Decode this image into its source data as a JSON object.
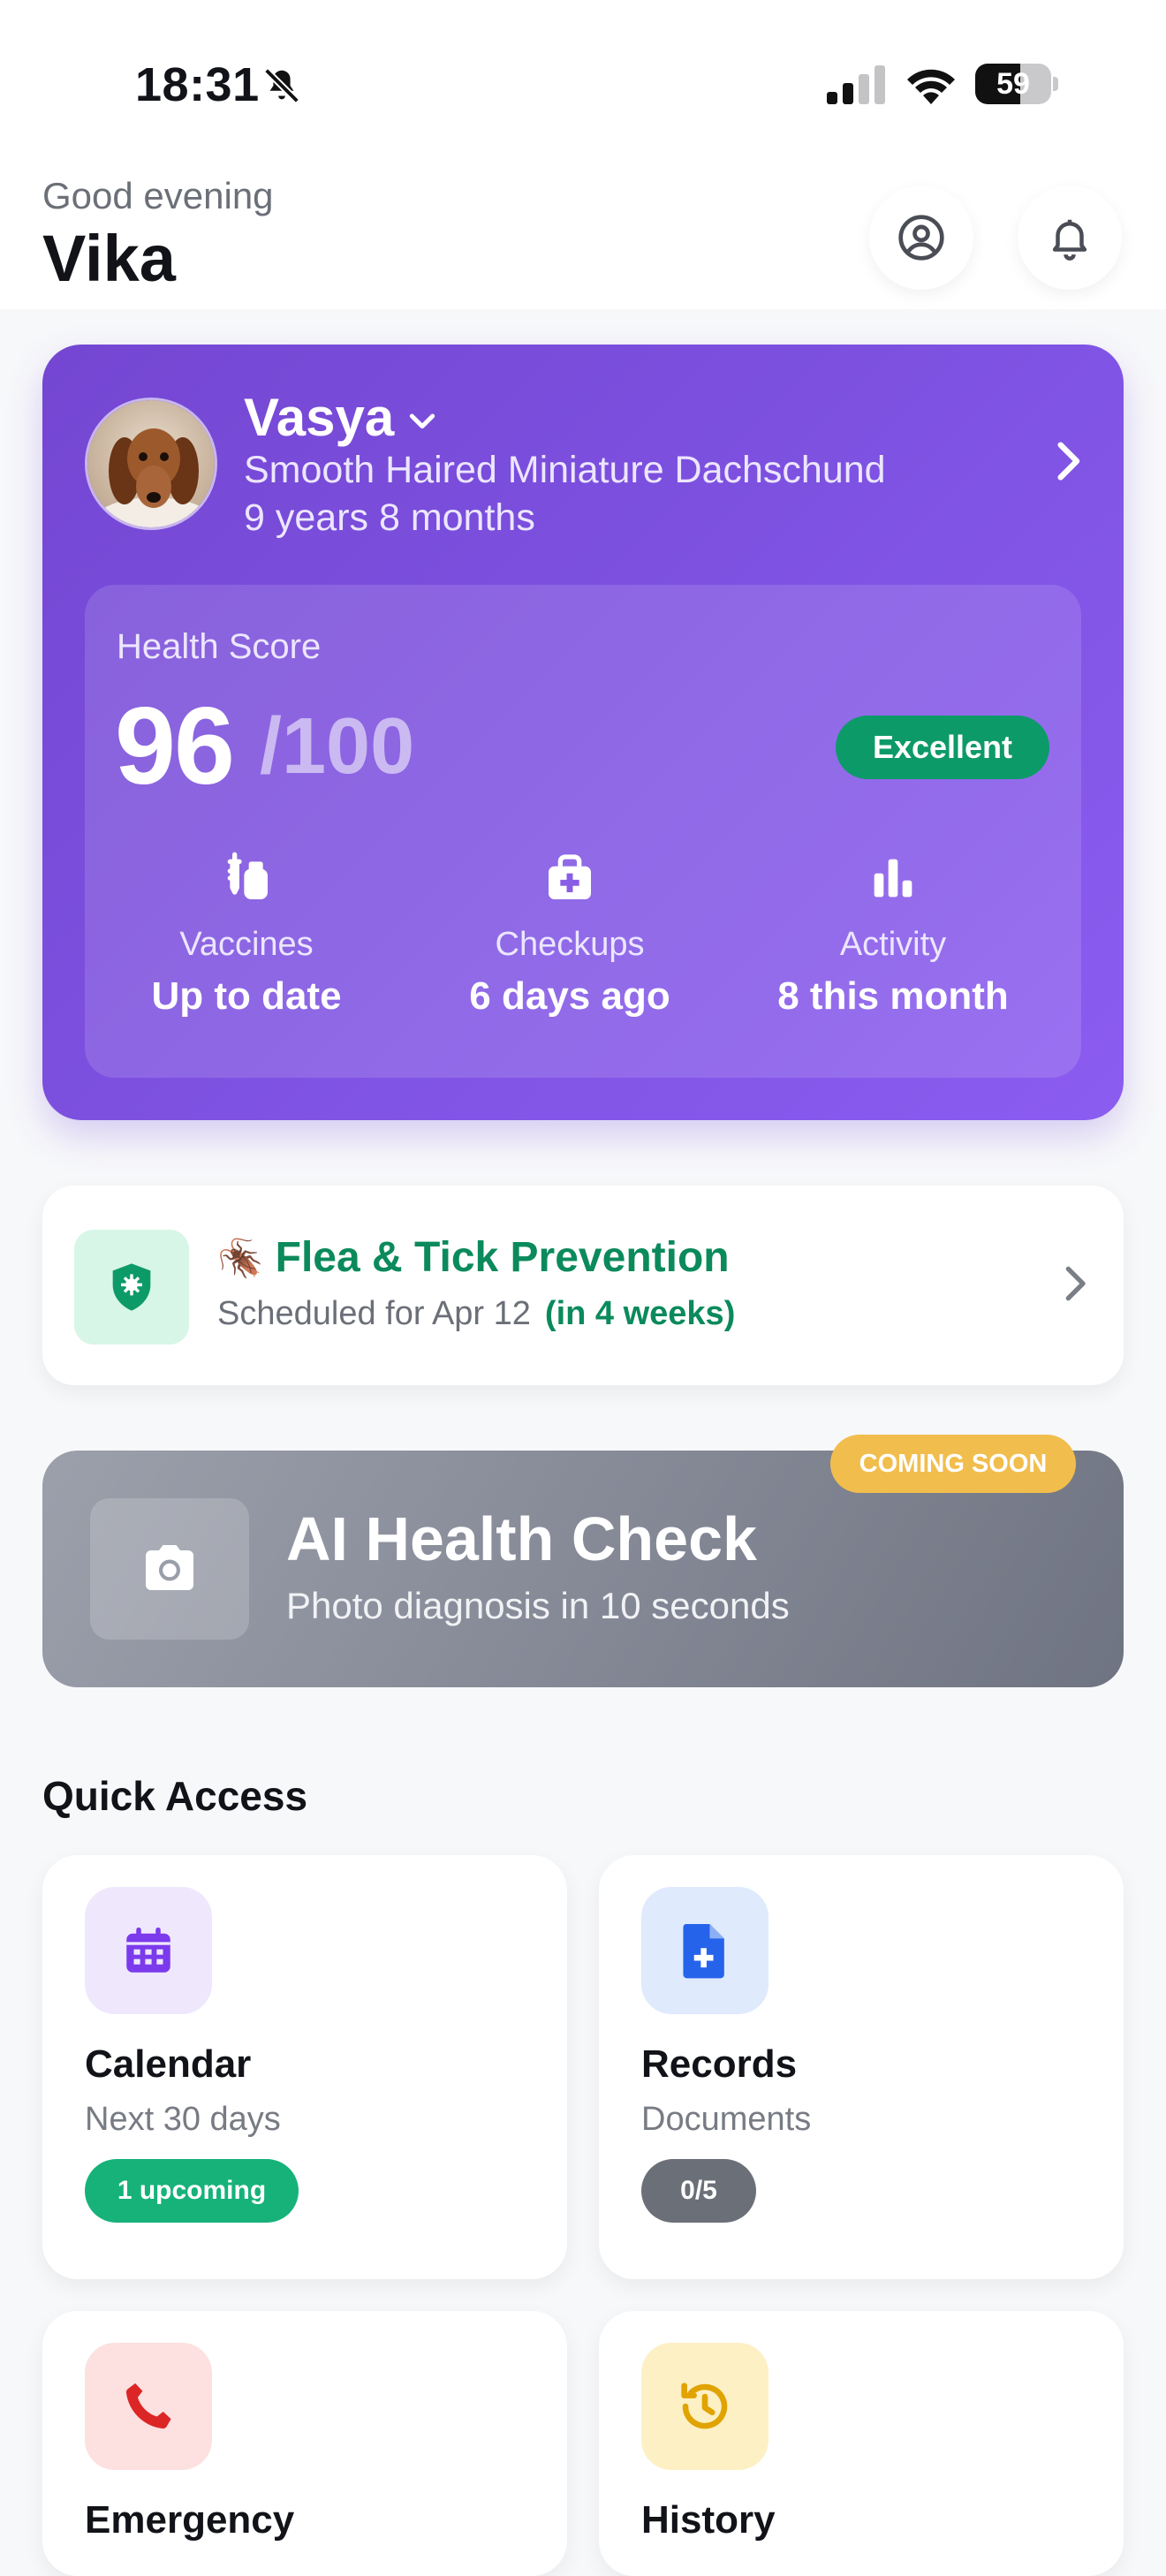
{
  "status_bar": {
    "time": "18:31",
    "battery_percent": 59,
    "battery_text": "59"
  },
  "header": {
    "greeting": "Good evening",
    "name": "Vika",
    "icons": [
      "profile-icon",
      "bell-icon"
    ]
  },
  "pet": {
    "name": "Vasya",
    "breed": "Smooth Haired Miniature Dachschund",
    "age": "9 years 8 months"
  },
  "health": {
    "label": "Health Score",
    "score": "96",
    "max": "/100",
    "badge": "Excellent",
    "stats": [
      {
        "icon": "vaccine-icon",
        "label": "Vaccines",
        "value": "Up to date"
      },
      {
        "icon": "medical-kit-icon",
        "label": "Checkups",
        "value": "6 days ago"
      },
      {
        "icon": "bar-chart-icon",
        "label": "Activity",
        "value": "8 this month"
      }
    ]
  },
  "reminder": {
    "emoji": "🪳",
    "title": "Flea & Tick Prevention",
    "subtitle": "Scheduled for Apr 12",
    "relative": "(in 4 weeks)"
  },
  "ai_check": {
    "badge": "COMING SOON",
    "title": "AI Health Check",
    "subtitle": "Photo diagnosis in 10 seconds"
  },
  "quick_access": {
    "title": "Quick Access",
    "tiles": [
      {
        "title": "Calendar",
        "subtitle": "Next 30 days",
        "pill": "1 upcoming",
        "icon": "calendar-icon",
        "accent": "#7c3aed",
        "icon_bg": "#efe8fd",
        "pill_color": "#16b27a"
      },
      {
        "title": "Records",
        "subtitle": "Documents",
        "pill": "0/5",
        "icon": "document-plus-icon",
        "accent": "#2563eb",
        "icon_bg": "#dfeafd",
        "pill_color": "#6b6f78"
      },
      {
        "title": "Emergency",
        "subtitle": "",
        "pill": "",
        "icon": "phone-icon",
        "accent": "#dc2626",
        "icon_bg": "#fde0e0",
        "pill_color": ""
      },
      {
        "title": "History",
        "subtitle": "",
        "pill": "",
        "icon": "history-icon",
        "accent": "#e0a300",
        "icon_bg": "#fdf0c4",
        "pill_color": ""
      }
    ]
  }
}
